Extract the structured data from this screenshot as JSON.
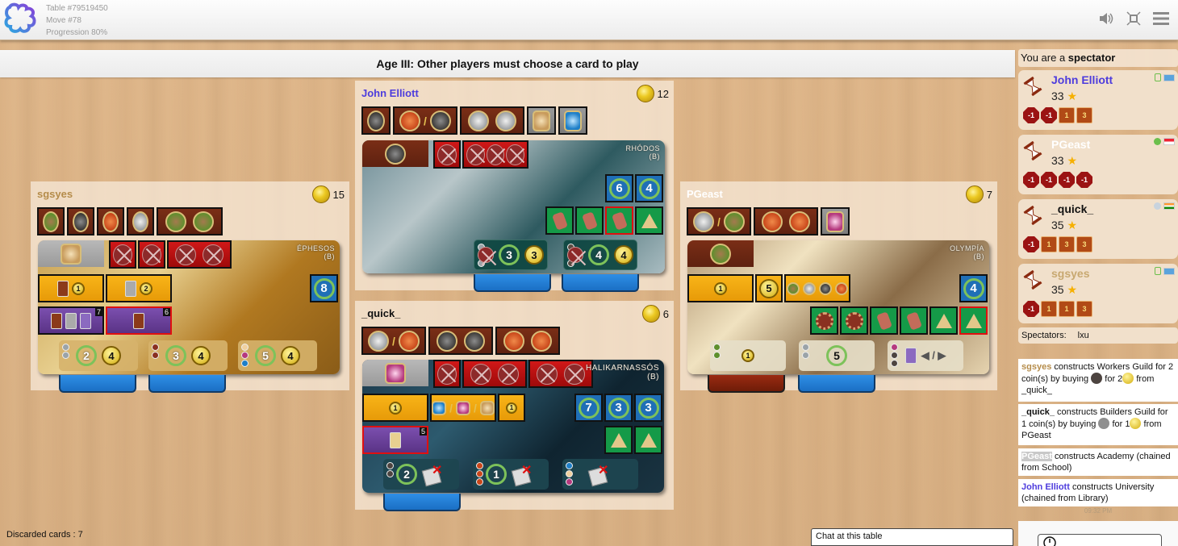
{
  "header": {
    "table": "Table #79519450",
    "move": "Move #78",
    "progression": "Progression 80%",
    "icons": [
      "sound-icon",
      "fullscreen-icon",
      "menu-icon"
    ]
  },
  "status": "Age III: Other players must choose a card to play",
  "colors": {
    "john_elliott": "#4d3cdd",
    "sgsyes": "#b58c4a",
    "pgeast": "#ffffff",
    "quick": "#111111"
  },
  "boards": {
    "john": {
      "name": "John Elliott",
      "coins": "12",
      "wonder": "RHÓDOS",
      "side": "(B)",
      "blue_vp": [
        "6",
        "4"
      ],
      "stages": [
        {
          "vp": "3",
          "coins": "3",
          "built": true
        },
        {
          "vp": "4",
          "coins": "4",
          "built": true
        }
      ]
    },
    "sgsyes": {
      "name": "sgsyes",
      "coins": "15",
      "wonder": "ÉPHESOS",
      "side": "(B)",
      "blue_vp": [
        "8"
      ],
      "yellow": [
        "1",
        "2"
      ],
      "purple_tags": [
        "7",
        "6"
      ],
      "stages": [
        {
          "vp": "2",
          "coins": "4",
          "built": true
        },
        {
          "vp": "3",
          "coins": "4",
          "built": true
        },
        {
          "vp": "5",
          "coins": "4",
          "built": false
        }
      ]
    },
    "pgeast": {
      "name": "PGeast",
      "coins": "7",
      "wonder": "OLYMPÍA",
      "side": "(B)",
      "blue_vp": [
        "4"
      ],
      "yellow": [
        "1",
        "5"
      ],
      "stages": [
        {
          "coin": "1",
          "built": true
        },
        {
          "vp": "5",
          "built": true
        },
        {
          "text": "◀ / ▶",
          "built": false
        }
      ]
    },
    "quick": {
      "name": "_quick_",
      "coins": "6",
      "wonder": "HALIKARNASSÓS",
      "side": "(B)",
      "blue_vp": [
        "7",
        "3",
        "3"
      ],
      "yellow": [
        "1",
        "1",
        "1"
      ],
      "purple_tags": [
        "5"
      ],
      "stages": [
        {
          "vp": "2",
          "built": true
        },
        {
          "vp": "1",
          "built": false
        },
        {
          "built": false
        }
      ]
    }
  },
  "sidebar": {
    "you_are_prefix": "You are a ",
    "you_are_role": "spectator",
    "players": [
      {
        "name": "John Elliott",
        "score": "33",
        "status": "online-square",
        "flag": "un",
        "tokens": [
          "-1",
          "-1",
          "1",
          "3"
        ]
      },
      {
        "name": "PGeast",
        "score": "33",
        "status": "online",
        "flag": "sg",
        "tokens": [
          "-1",
          "-1",
          "-1",
          "-1"
        ]
      },
      {
        "name": "_quick_",
        "score": "35",
        "status": "away",
        "flag": "in",
        "tokens": [
          "-1",
          "1",
          "3",
          "3"
        ]
      },
      {
        "name": "sgsyes",
        "score": "35",
        "status": "online-square",
        "flag": "un",
        "tokens": [
          "-1",
          "1",
          "1",
          "3"
        ]
      }
    ],
    "star": "★",
    "spectators_label": "Spectators:",
    "spectators": "lxu",
    "log": [
      {
        "who": "sgsyes",
        "text1": " constructs Workers Guild for 2 coin(s) by buying ",
        "text2": " for 2",
        "text3": " from _quick_"
      },
      {
        "who": "_quick_",
        "text1": " constructs Builders Guild for 1 coin(s) by buying ",
        "text2": " for 1",
        "text3": " from PGeast"
      },
      {
        "who": "PGeast",
        "text1": " constructs Academy (chained from School)"
      },
      {
        "who": "John Elliott",
        "text1": " constructs University (chained from Library)"
      }
    ],
    "timestamp": "09:32 PM"
  },
  "footer": {
    "discarded": "Discarded cards : 7",
    "chat_title": "Chat at this table"
  }
}
